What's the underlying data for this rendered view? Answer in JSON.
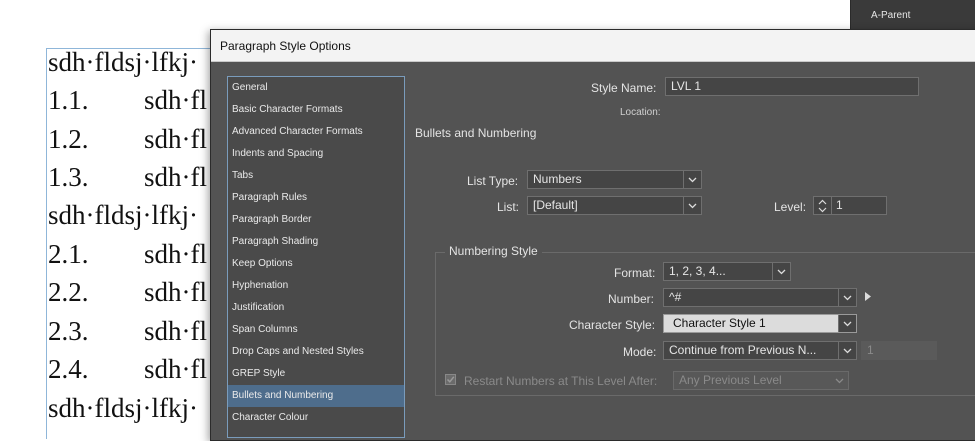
{
  "document": {
    "lines": [
      {
        "num": "",
        "text": "sdh·fldsj·lfkj·"
      },
      {
        "num": "1.1.",
        "text": "sdh·fl"
      },
      {
        "num": "1.2.",
        "text": "sdh·fl"
      },
      {
        "num": "1.3.",
        "text": "sdh·fl"
      },
      {
        "num": "",
        "text": "sdh·fldsj·lfkj·"
      },
      {
        "num": "2.1.",
        "text": "sdh·fl"
      },
      {
        "num": "2.2.",
        "text": "sdh·fl"
      },
      {
        "num": "2.3.",
        "text": "sdh·fl"
      },
      {
        "num": "2.4.",
        "text": "sdh·fl"
      },
      {
        "num": "",
        "text": "sdh·fldsj·lfkj·"
      }
    ]
  },
  "pages_panel": {
    "label": "A-Parent"
  },
  "dialog": {
    "title": "Paragraph Style Options",
    "sidebar": [
      {
        "label": "General"
      },
      {
        "label": "Basic Character Formats"
      },
      {
        "label": "Advanced Character Formats"
      },
      {
        "label": "Indents and Spacing"
      },
      {
        "label": "Tabs"
      },
      {
        "label": "Paragraph Rules"
      },
      {
        "label": "Paragraph Border"
      },
      {
        "label": "Paragraph Shading"
      },
      {
        "label": "Keep Options"
      },
      {
        "label": "Hyphenation"
      },
      {
        "label": "Justification"
      },
      {
        "label": "Span Columns"
      },
      {
        "label": "Drop Caps and Nested Styles"
      },
      {
        "label": "GREP Style"
      },
      {
        "label": "Bullets and Numbering",
        "active": true
      },
      {
        "label": "Character Colour"
      }
    ],
    "style_name_label": "Style Name:",
    "style_name_value": "LVL 1",
    "location_label": "Location:",
    "section_title": "Bullets and Numbering",
    "list_type_label": "List Type:",
    "list_type_value": "Numbers",
    "list_label": "List:",
    "list_value": "[Default]",
    "level_label": "Level:",
    "level_value": "1",
    "numbering_style_title": "Numbering Style",
    "format_label": "Format:",
    "format_value": "1, 2, 3, 4...",
    "number_label": "Number:",
    "number_value": "^#",
    "char_style_label": "Character Style:",
    "char_style_value": "Character Style 1",
    "mode_label": "Mode:",
    "mode_value": "Continue from Previous N...",
    "mode_start_value": "1",
    "restart_label": "Restart Numbers at This Level After:",
    "restart_value": "Any Previous Level"
  },
  "colors": {
    "dialog_bg": "#535353",
    "active_item": "#4e6d8c",
    "frame_edge": "#8fb6d9"
  }
}
